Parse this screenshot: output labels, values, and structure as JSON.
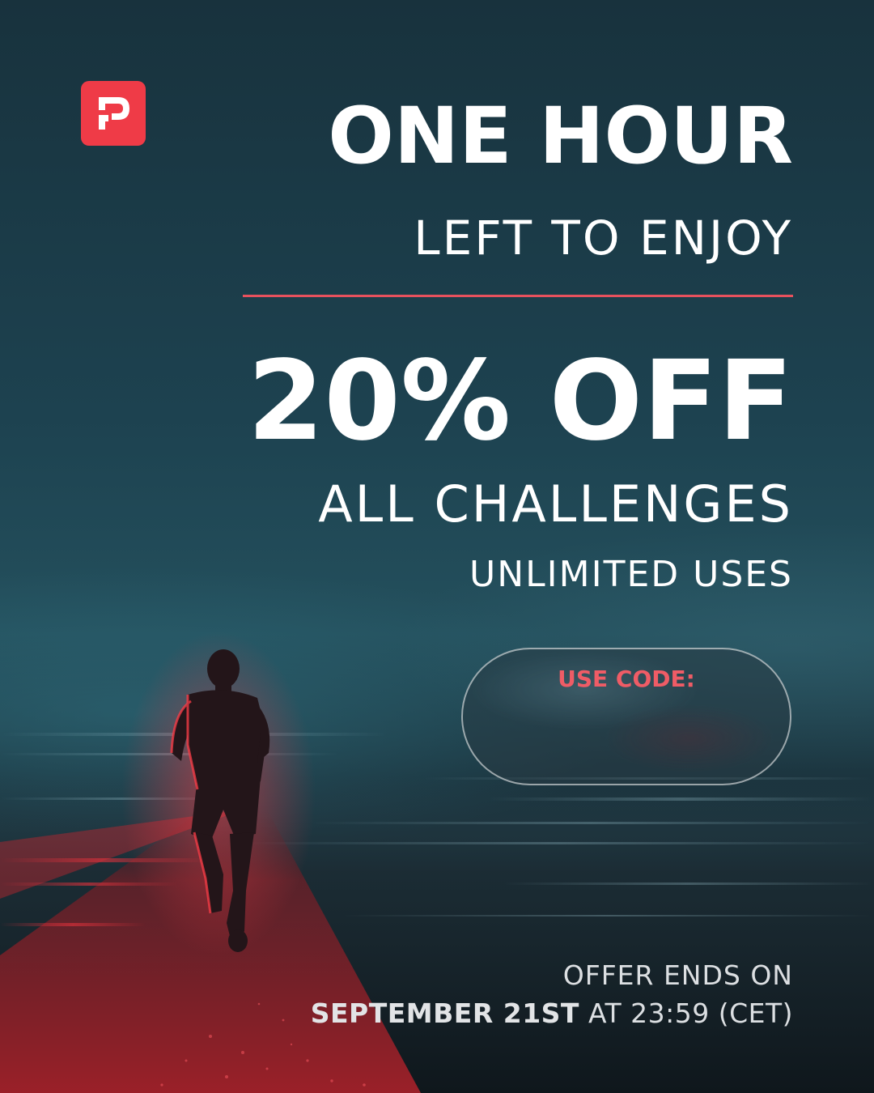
{
  "brand": {
    "logo_icon": "brand-p-logo-icon",
    "logo_color": "#ef3b47"
  },
  "headline": "ONE HOUR",
  "subheadline": "LEFT TO ENJOY",
  "discount": "20% OFF",
  "scope": "ALL CHALLENGES",
  "usage": "UNLIMITED USES",
  "code_box": {
    "label": "USE CODE:",
    "code": ""
  },
  "offer": {
    "line1": "OFFER ENDS ON",
    "date": "SEPTEMBER 21ST",
    "time": "AT 23:59 (CET)"
  },
  "colors": {
    "accent": "#e8515d",
    "text": "#ffffff",
    "background": "#1d3f4b"
  }
}
